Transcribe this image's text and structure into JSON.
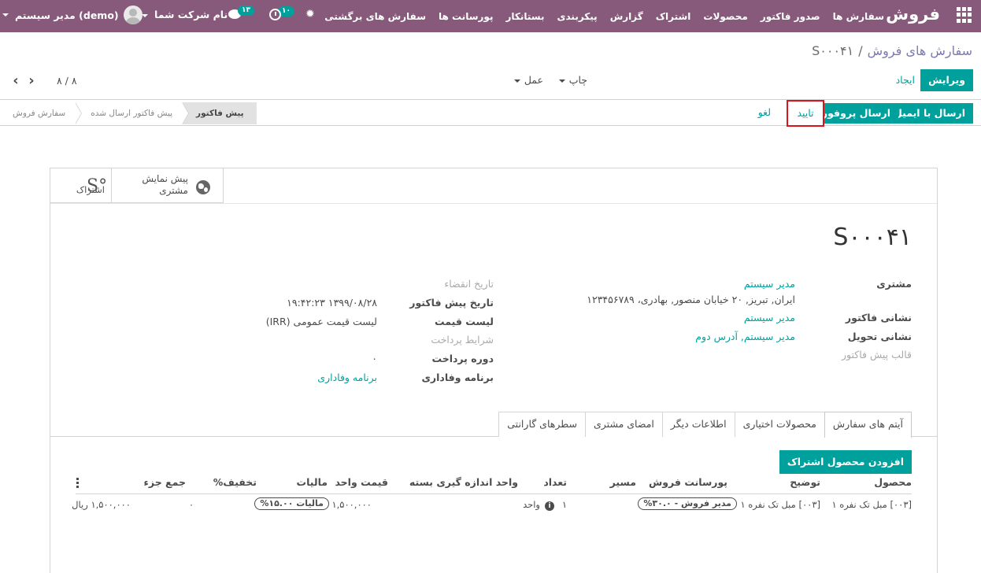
{
  "navbar": {
    "brand": "فروش",
    "menu": [
      "سفارش ها",
      "صدور فاکتور",
      "محصولات",
      "اشتراک",
      "گزارش",
      "پیکربندی",
      "بستانکار",
      "پورسانت ها",
      "سفارش های برگشتی"
    ],
    "chat_badge": "۱۳",
    "activity_badge": "۱۰",
    "company": "نام شرکت شما",
    "user": "مدیر سیستم (demo)",
    "color": "#875a7b"
  },
  "breadcrumb": {
    "parent": "سفارش های فروش",
    "separator": "/",
    "current": "S۰۰۰۴۱"
  },
  "control": {
    "edit": "ویرایش",
    "create": "ایجاد",
    "print": "چاپ",
    "action": "عمل",
    "pager": "۸ / ۸"
  },
  "statusbar": {
    "send_email": "ارسال با ایمیل",
    "send_proforma": "ارسال پروفورما",
    "confirm": "تایید",
    "cancel": "لغو",
    "stages": [
      "پیش فاکتور",
      "پیش فاکتور ارسال شده",
      "سفارش فروش"
    ],
    "current_stage": "پیش فاکتور"
  },
  "sheet": {
    "follow": "اشتراک",
    "customer_preview": [
      "پیش نمایش",
      "مشتری"
    ],
    "order_name": "S۰۰۰۴۱",
    "fields_right": {
      "customer_label": "مشتری",
      "customer_value": "مدیر سیستم",
      "customer_address": "ایران, تبریز, ۲۰ خیابان منصور, بهادری، ۱۲۳۴۵۶۷۸۹",
      "invoice_address_label": "نشانی فاکتور",
      "invoice_address_value": "مدیر سیستم",
      "delivery_address_label": "نشانی تحویل",
      "delivery_address_value": "مدیر سیستم, آدرس دوم",
      "template_label": "قالب پیش فاکتور"
    },
    "fields_left": {
      "expiration_label": "تاریخ انقضاء",
      "quotation_date_label": "تاریخ پیش فاکتور",
      "quotation_date_value": "۱۳۹۹/۰۸/۲۸ ۱۹:۴۲:۲۳",
      "pricelist_label": "لیست قیمت",
      "pricelist_value": "لیست قیمت عمومی (IRR)",
      "payment_terms_label": "شرایط پرداخت",
      "payment_period_label": "دوره پرداخت",
      "payment_period_value": "۰",
      "loyalty_label": "برنامه وفاداری",
      "loyalty_value": "برنامه وفاداری"
    }
  },
  "tabs": [
    "آیتم های سفارش",
    "محصولات اختیاری",
    "اطلاعات دیگر",
    "امضای مشتری",
    "سطرهای گارانتی"
  ],
  "add_subscription_button": "افزودن محصول اشتراک",
  "table": {
    "headers": [
      "محصول",
      "توضیح",
      "پورسانت فروش",
      "مسیر",
      "تعداد",
      "واحد اندازه گیری",
      "بسته",
      "قیمت واحد",
      "مالیات",
      "تخفیف%",
      "جمع جزء"
    ],
    "row": {
      "product": "[۰۰۳] مبل تک نفره ۱",
      "description": "[۰۰۳] مبل تک نفره ۱",
      "commission": "مدیر فروش - ۳۰.۰%",
      "route": "",
      "quantity": "۱",
      "uom": "واحد",
      "package": "",
      "unit_price": "۱,۵۰۰,۰۰۰",
      "tax": "مالیات ۱۵.۰۰%",
      "discount": "۰",
      "subtotal": "۱,۵۰۰,۰۰۰ ریال"
    }
  }
}
